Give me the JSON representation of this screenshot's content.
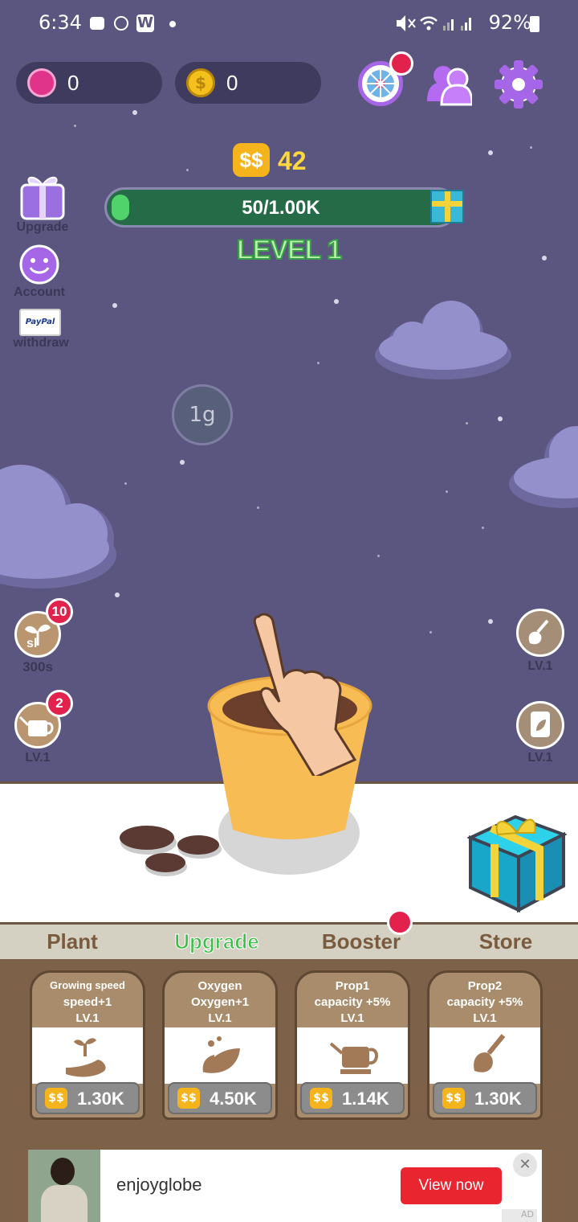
{
  "status_bar": {
    "time": "6:34",
    "battery": "92%"
  },
  "currency": {
    "gems": "0",
    "coins": "0"
  },
  "progress": {
    "cash": "42",
    "bar_text": "50/1.00K",
    "fraction": 0.05,
    "level": "LEVEL 1"
  },
  "left_menu": {
    "upgrade": "Upgrade",
    "account": "Account",
    "withdraw": "withdraw",
    "paypal": "PayPal"
  },
  "floating": {
    "weight": "1g"
  },
  "side_buttons": {
    "seed_badge": "10",
    "seed_timer": "300s",
    "seed_icon_text": "sl",
    "water_badge": "2",
    "water_level": "LV.1",
    "shovel_level": "LV.1",
    "bag_level": "LV.1"
  },
  "tabs": [
    {
      "label": "Plant",
      "active": false
    },
    {
      "label": "Upgrade",
      "active": true
    },
    {
      "label": "Booster",
      "active": false
    },
    {
      "label": "Store",
      "active": false
    }
  ],
  "cards": [
    {
      "title": "Growing speed",
      "line2": "speed+1",
      "level": "LV.1",
      "price": "1.30K",
      "icon": "hand-sprout-icon"
    },
    {
      "title": "Oxygen",
      "line2": "Oxygen+1",
      "level": "LV.1",
      "price": "4.50K",
      "icon": "leaves-icon"
    },
    {
      "title": "Prop1",
      "line2": "capacity +5%",
      "level": "LV.1",
      "price": "1.14K",
      "icon": "watering-can-icon"
    },
    {
      "title": "Prop2",
      "line2": "capacity +5%",
      "level": "LV.1",
      "price": "1.30K",
      "icon": "trowel-icon"
    }
  ],
  "ad": {
    "brand": "enjoyglobe",
    "cta": "View now",
    "tag": "AD"
  },
  "colors": {
    "sky": "#5b567f",
    "accent_green": "#3bbf48",
    "badge_red": "#e3214d",
    "panel_brown": "#7d6149"
  }
}
